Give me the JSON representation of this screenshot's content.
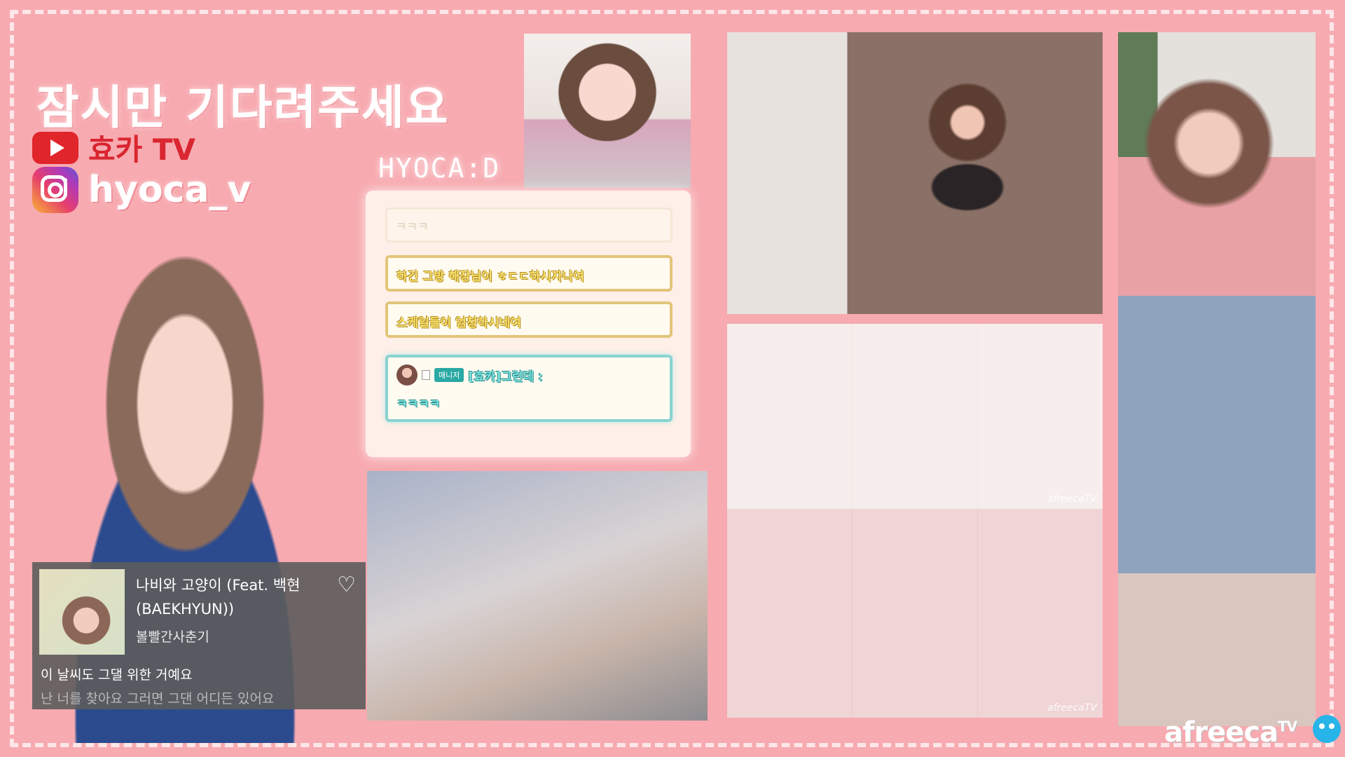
{
  "title": "잠시만 기다려주세요",
  "social": {
    "youtube": {
      "label": "효카 TV",
      "icon": "youtube-icon",
      "color": "#e0252b"
    },
    "instagram": {
      "label": "hyoca_v",
      "icon": "instagram-icon"
    }
  },
  "brand": "HYOCA:D",
  "chat": {
    "messages": [
      {
        "text": "ㅋㅋㅋ"
      },
      {
        "text": "하긴 그방 해장님이 ㅎㄷㄷ하시자나여"
      },
      {
        "text": "스케일들이 엄청하시네여"
      },
      {
        "badge": "매니저",
        "nick": "[효카]그런데 :",
        "text": "ㅋㅋㅋㅋ"
      }
    ]
  },
  "music": {
    "song": "나비와 고양이 (Feat. 백현 (BAEKHYUN))",
    "artist": "볼빨간사춘기",
    "lyric_current": "이 날씨도 그댈 위한 거예요",
    "lyric_next": "난 너를 찾아요 그러면 그댄 어디든 있어요"
  },
  "watermark": "afreecaTV",
  "footer_logo": {
    "main": "afreeca",
    "sup": "TV"
  },
  "colors": {
    "background": "#f7aab0",
    "chat_yellow": "#f7e06b",
    "chat_teal": "#7de2df"
  }
}
